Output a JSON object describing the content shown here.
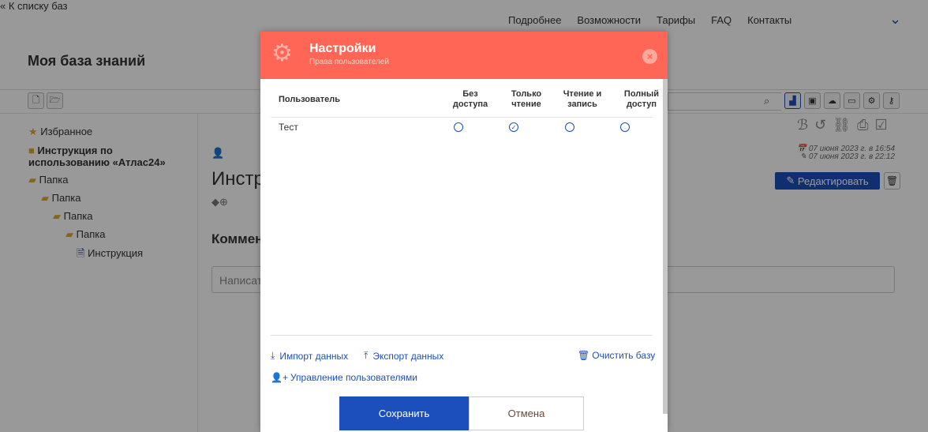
{
  "header": {
    "back": "К списку баз",
    "nav": [
      "Подробнее",
      "Возможности",
      "Тарифы",
      "FAQ",
      "Контакты"
    ],
    "title": "Моя база знаний"
  },
  "sidebar": {
    "favorites": "Избранное",
    "root": "Инструкция по использованию «Атлас24»",
    "folders": [
      "Папка",
      "Папка",
      "Папка",
      "Папка"
    ],
    "doc": "Инструкция"
  },
  "content": {
    "title": "Инстр",
    "comments": "Коммен",
    "comment_placeholder": "Написат",
    "created": "07 июня 2023 г. в 16:54",
    "modified": "07 июня 2023 г. в 22:12",
    "edit": "Редактировать"
  },
  "modal": {
    "title": "Настройки",
    "subtitle": "Права пользователей",
    "columns": {
      "user": "Пользователь",
      "none": [
        "Без",
        "доступа"
      ],
      "read": [
        "Только",
        "чтение"
      ],
      "rw": [
        "Чтение и",
        "запись"
      ],
      "full": [
        "Полный",
        "доступ"
      ]
    },
    "rows": [
      {
        "user": "Тест",
        "access": "read"
      }
    ],
    "import": "Импорт данных",
    "export": "Экспорт данных",
    "clear": "Очистить базу",
    "users": "Управление пользователями",
    "save": "Сохранить",
    "cancel": "Отмена"
  },
  "colors": {
    "accent": "#1c4fbc",
    "modal_header": "#ff6655"
  }
}
